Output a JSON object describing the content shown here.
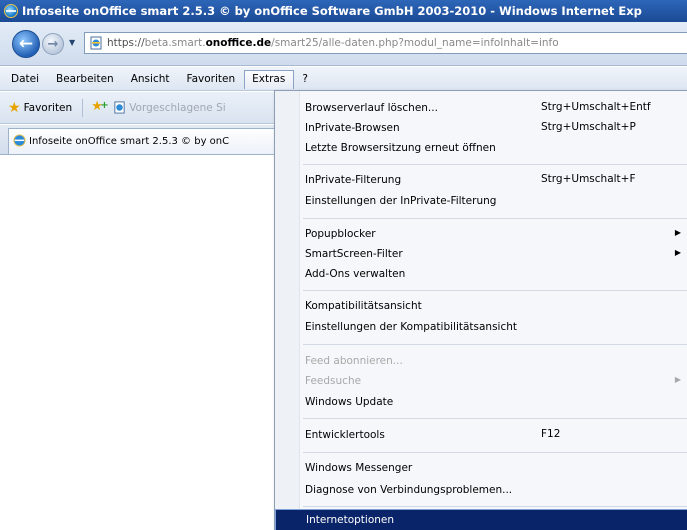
{
  "window": {
    "title": "Infoseite onOffice smart 2.5.3 © by onOffice Software GmbH 2003-2010 - Windows Internet Exp"
  },
  "address_bar": {
    "url_scheme": "https://",
    "url_sub": "beta.smart.",
    "url_domain": "onoffice.de",
    "url_path": "/smart25/alle-daten.php?modul_name=infoInhalt=info"
  },
  "menubar": {
    "items": [
      "Datei",
      "Bearbeiten",
      "Ansicht",
      "Favoriten",
      "Extras",
      "?"
    ]
  },
  "favorites_bar": {
    "label": "Favoriten",
    "suggested": "Vorgeschlagene Si"
  },
  "tab": {
    "label": "Infoseite onOffice smart 2.5.3 © by onC"
  },
  "extras_menu": {
    "items": [
      {
        "label": "Browserverlauf löschen...",
        "shortcut": "Strg+Umschalt+Entf"
      },
      {
        "label": "InPrivate-Browsen",
        "shortcut": "Strg+Umschalt+P"
      },
      {
        "label": "Letzte Browsersitzung erneut öffnen",
        "shortcut": ""
      },
      {
        "label": "InPrivate-Filterung",
        "shortcut": "Strg+Umschalt+F"
      },
      {
        "label": "Einstellungen der InPrivate-Filterung",
        "shortcut": ""
      },
      {
        "label": "Popupblocker",
        "shortcut": ""
      },
      {
        "label": "SmartScreen-Filter",
        "shortcut": ""
      },
      {
        "label": "Add-Ons verwalten",
        "shortcut": ""
      },
      {
        "label": "Kompatibilitätsansicht",
        "shortcut": ""
      },
      {
        "label": "Einstellungen der Kompatibilitätsansicht",
        "shortcut": ""
      },
      {
        "label": "Feed abonnieren...",
        "shortcut": ""
      },
      {
        "label": "Feedsuche",
        "shortcut": ""
      },
      {
        "label": "Windows Update",
        "shortcut": ""
      },
      {
        "label": "Entwicklertools",
        "shortcut": "F12"
      },
      {
        "label": "Windows Messenger",
        "shortcut": ""
      },
      {
        "label": "Diagnose von Verbindungsproblemen...",
        "shortcut": ""
      },
      {
        "label": "Internetoptionen",
        "shortcut": ""
      }
    ]
  },
  "colors": {
    "titlebar": "#1c4a94",
    "menu_highlight": "#0a246a",
    "disabled_text": "#a8a8a8"
  }
}
